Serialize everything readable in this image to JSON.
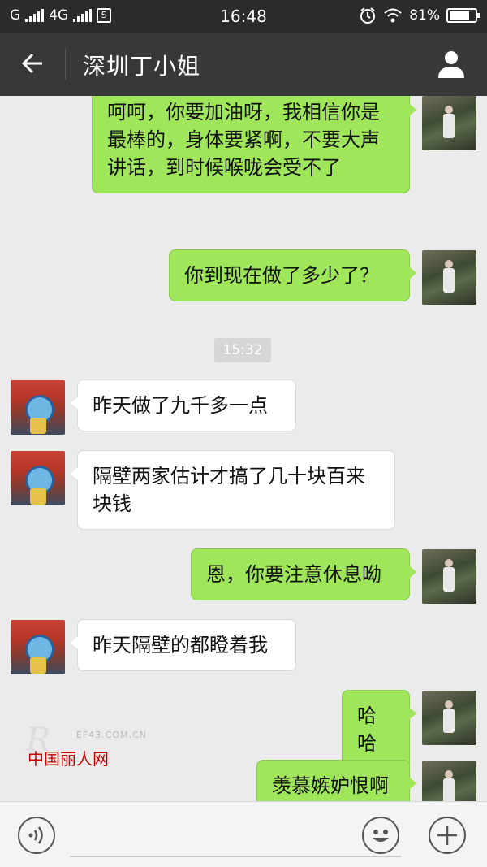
{
  "status_bar": {
    "carrier1": "G",
    "network": "4G",
    "time": "16:48",
    "battery": "81%",
    "battery_level": 0.81
  },
  "header": {
    "title": "深圳丁小姐",
    "back_icon": "arrow-left-icon",
    "profile_icon": "person-icon"
  },
  "messages": [
    {
      "from": "me",
      "text": "呵呵，你要加油呀，我相信你是最棒的，身体要紧啊，不要大声讲话，到时候喉咙会受不了"
    },
    {
      "from": "me",
      "text": "你到现在做了多少了？"
    },
    {
      "from": "system",
      "text": "15:32"
    },
    {
      "from": "her",
      "text": "昨天做了九千多一点"
    },
    {
      "from": "her",
      "text": "隔壁两家估计才搞了几十块百来块钱"
    },
    {
      "from": "me",
      "text": "恩，你要注意休息呦"
    },
    {
      "from": "her",
      "text": "昨天隔壁的都瞪着我"
    },
    {
      "from": "me",
      "text": "哈哈"
    },
    {
      "from": "me",
      "text": "羡慕嫉妒恨啊"
    }
  ],
  "watermark": {
    "site": "EF43.COM.CN",
    "brand": "中国丽人网"
  },
  "input_bar": {
    "voice_icon": "voice-icon",
    "emoji_icon": "emoji-icon",
    "plus_icon": "plus-icon"
  }
}
